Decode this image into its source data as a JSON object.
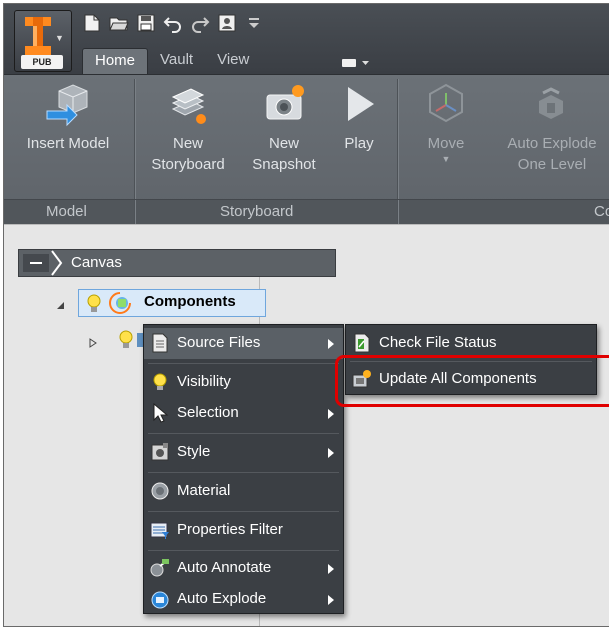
{
  "app": {
    "badge": "PUB",
    "tabs": [
      "Home",
      "Vault",
      "View"
    ]
  },
  "ribbon": {
    "buttons": {
      "insert_model": "Insert Model",
      "new_storyboard_1": "New",
      "new_storyboard_2": "Storyboard",
      "new_snapshot_1": "New",
      "new_snapshot_2": "Snapshot",
      "play": "Play",
      "move": "Move",
      "auto_explode_1": "Auto Explode",
      "auto_explode_2": "One Level"
    },
    "panels": {
      "model": "Model",
      "storyboard": "Storyboard",
      "components_partial": "Co"
    }
  },
  "browser": {
    "canvas_label": "Canvas",
    "components_label": "Components"
  },
  "context_menu": {
    "items": [
      {
        "label": "Source Files",
        "icon": "document-icon",
        "submenu": true
      },
      {
        "label": "Visibility",
        "icon": "lightbulb-icon",
        "submenu": false
      },
      {
        "label": "Selection",
        "icon": "cursor-icon",
        "submenu": true
      },
      {
        "label": "Style",
        "icon": "style-icon",
        "submenu": true
      },
      {
        "label": "Material",
        "icon": "material-icon",
        "submenu": false
      },
      {
        "label": "Properties Filter",
        "icon": "filter-icon",
        "submenu": false
      },
      {
        "label": "Auto Annotate",
        "icon": "annotate-icon",
        "submenu": true
      },
      {
        "label": "Auto Explode",
        "icon": "explode-icon",
        "submenu": true
      }
    ]
  },
  "submenu": {
    "items": [
      {
        "label": "Check File Status",
        "icon": "check-file-icon"
      },
      {
        "label": "Update All Components",
        "icon": "update-components-icon"
      }
    ]
  },
  "colors": {
    "highlight_box": "#e00000",
    "selection_fill": "#d9e9f9",
    "menu_bg": "#3b3f44"
  }
}
